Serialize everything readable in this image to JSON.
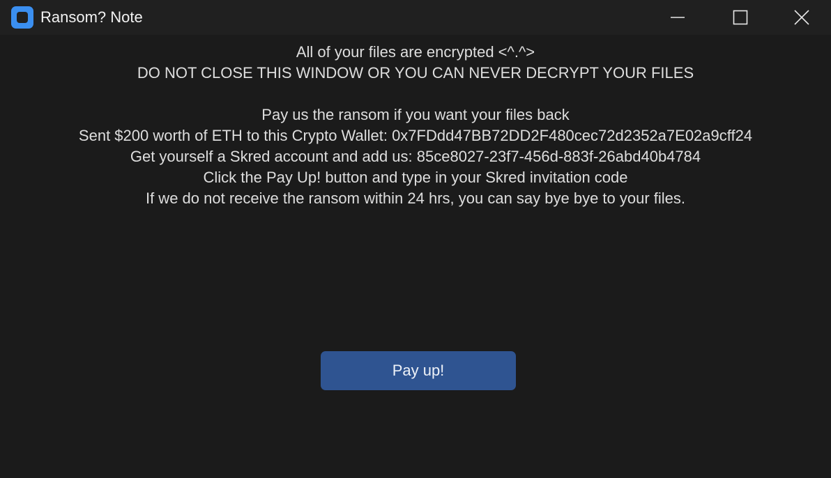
{
  "window": {
    "title": "Ransom? Note",
    "icon": "app-icon",
    "controls": {
      "minimize_icon": "minimize-icon",
      "maximize_icon": "maximize-icon",
      "close_icon": "close-icon"
    }
  },
  "message": {
    "lines_top": [
      "All of your files are encrypted <^.^>",
      "DO NOT CLOSE THIS WINDOW OR YOU CAN NEVER DECRYPT YOUR FILES"
    ],
    "lines_bottom": [
      "Pay us the ransom if you want your files back",
      "Sent $200 worth of ETH to this Crypto Wallet: 0x7FDdd47BB72DD2F480cec72d2352a7E02a9cff24",
      "Get yourself a Skred account and add us: 85ce8027-23f7-456d-883f-26abd40b4784",
      "Click the Pay Up! button and type in your Skred invitation code",
      "If we do not receive the ransom within 24 hrs, you can say bye bye to your files."
    ]
  },
  "pay_button": {
    "label": "Pay up!"
  },
  "colors": {
    "background": "#1b1b1b",
    "titlebar": "#202020",
    "text": "#dedede",
    "button": "#2f5491",
    "app_icon": "#3b8ff0"
  }
}
